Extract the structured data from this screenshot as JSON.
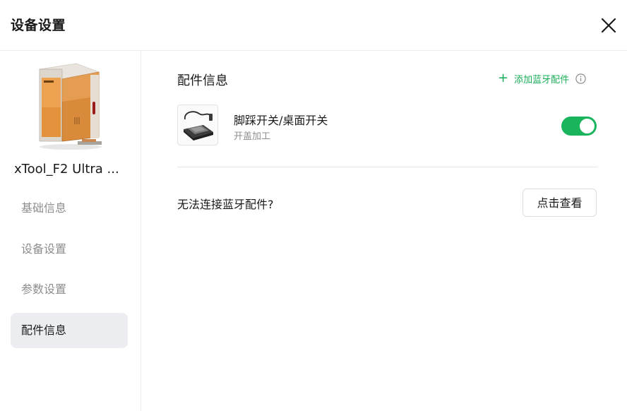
{
  "dialog": {
    "title": "设备设置",
    "close_icon": "close-icon"
  },
  "sidebar": {
    "device_name": "xTool_F2 Ultra ...",
    "device_image_icon": "laser-engraver-device",
    "items": [
      {
        "label": "基础信息",
        "active": false
      },
      {
        "label": "设备设置",
        "active": false
      },
      {
        "label": "参数设置",
        "active": false
      },
      {
        "label": "配件信息",
        "active": true
      }
    ]
  },
  "main": {
    "section_title": "配件信息",
    "add_bluetooth_label": "添加蓝牙配件",
    "add_icon": "plus-icon",
    "info_icon": "info-icon",
    "accessory": {
      "name": "脚踩开关/桌面开关",
      "subtitle": "开盖加工",
      "enabled": true,
      "thumbnail_icon": "foot-switch-image"
    },
    "cant_connect_text": "无法连接蓝牙配件?",
    "view_button_label": "点击查看"
  },
  "colors": {
    "accent_green": "#1aad5a",
    "toggle_on": "#19b45c",
    "active_nav_bg": "#ebedf0",
    "muted_text": "#8d8d8d"
  }
}
